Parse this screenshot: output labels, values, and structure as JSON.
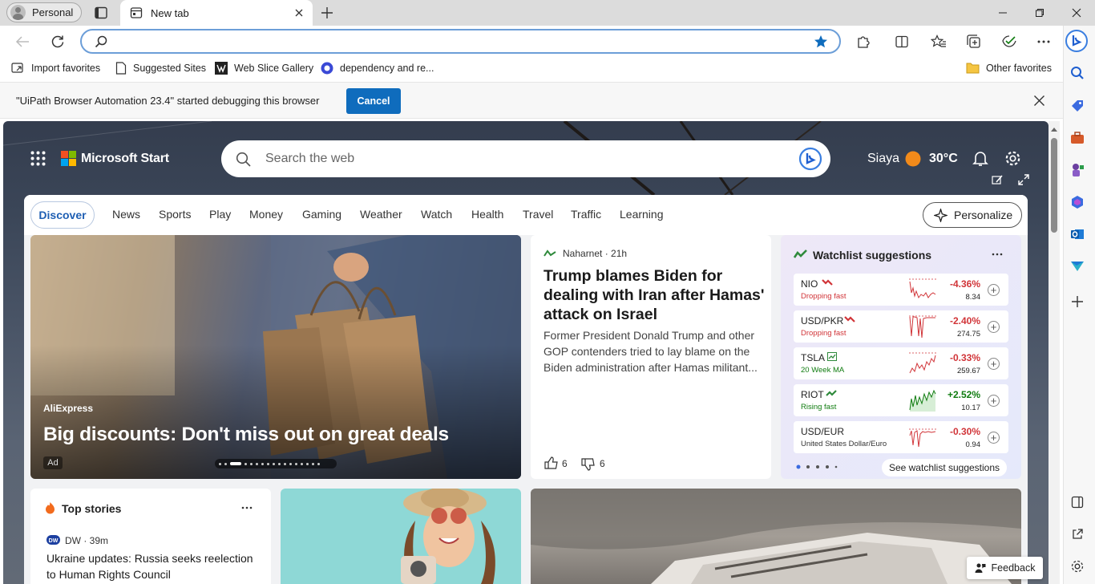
{
  "browser": {
    "profile_label": "Personal",
    "tab_title": "New tab",
    "address_value": "",
    "favorites": [
      {
        "label": "Import favorites",
        "icon": "import-icon"
      },
      {
        "label": "Suggested Sites",
        "icon": "page-icon"
      },
      {
        "label": "Web Slice Gallery",
        "icon": "slice-icon"
      },
      {
        "label": "dependency and re...",
        "icon": "site-icon"
      }
    ],
    "other_favorites": "Other favorites",
    "infobar": {
      "message": "\"UiPath Browser Automation 23.4\" started debugging this browser",
      "cancel_label": "Cancel"
    }
  },
  "start": {
    "brand": "Microsoft Start",
    "search_placeholder": "Search the web",
    "location": "Siaya",
    "temperature": "30°C",
    "nav_tabs": [
      "Discover",
      "News",
      "Sports",
      "Play",
      "Money",
      "Gaming",
      "Weather",
      "Watch",
      "Health",
      "Travel",
      "Traffic",
      "Learning"
    ],
    "personalize_label": "Personalize",
    "hero": {
      "source": "AliExpress",
      "title": "Big discounts: Don't miss out on great deals",
      "ad_label": "Ad"
    },
    "article": {
      "source": "Naharnet · 21h",
      "title": "Trump blames Biden for dealing with Iran after Hamas' attack on Israel",
      "body": "Former President Donald Trump and other GOP contenders tried to lay blame on the Biden administration after Hamas militant...",
      "likes": "6",
      "dislikes": "6"
    },
    "watchlist": {
      "title": "Watchlist suggestions",
      "see_more": "See watchlist suggestions",
      "stocks": [
        {
          "symbol": "NIO",
          "note": "Dropping fast",
          "change": "-4.36%",
          "price": "8.34",
          "trend": "down"
        },
        {
          "symbol": "USD/PKR",
          "note": "Dropping fast",
          "change": "-2.40%",
          "price": "274.75",
          "trend": "down"
        },
        {
          "symbol": "TSLA",
          "note": "20 Week MA",
          "change": "-0.33%",
          "price": "259.67",
          "trend": "down"
        },
        {
          "symbol": "RIOT",
          "note": "Rising fast",
          "change": "+2.52%",
          "price": "10.17",
          "trend": "up"
        },
        {
          "symbol": "USD/EUR",
          "note": "United States Dollar/Euro",
          "change": "-0.30%",
          "price": "0.94",
          "trend": "down"
        }
      ]
    },
    "top_stories": {
      "title": "Top stories",
      "source": "DW · 39m",
      "headline": "Ukraine updates: Russia seeks reelection to Human Rights Council"
    },
    "feedback_label": "Feedback"
  },
  "colors": {
    "accent": "#0f6cbd",
    "down": "#d13438",
    "up": "#107c10"
  }
}
